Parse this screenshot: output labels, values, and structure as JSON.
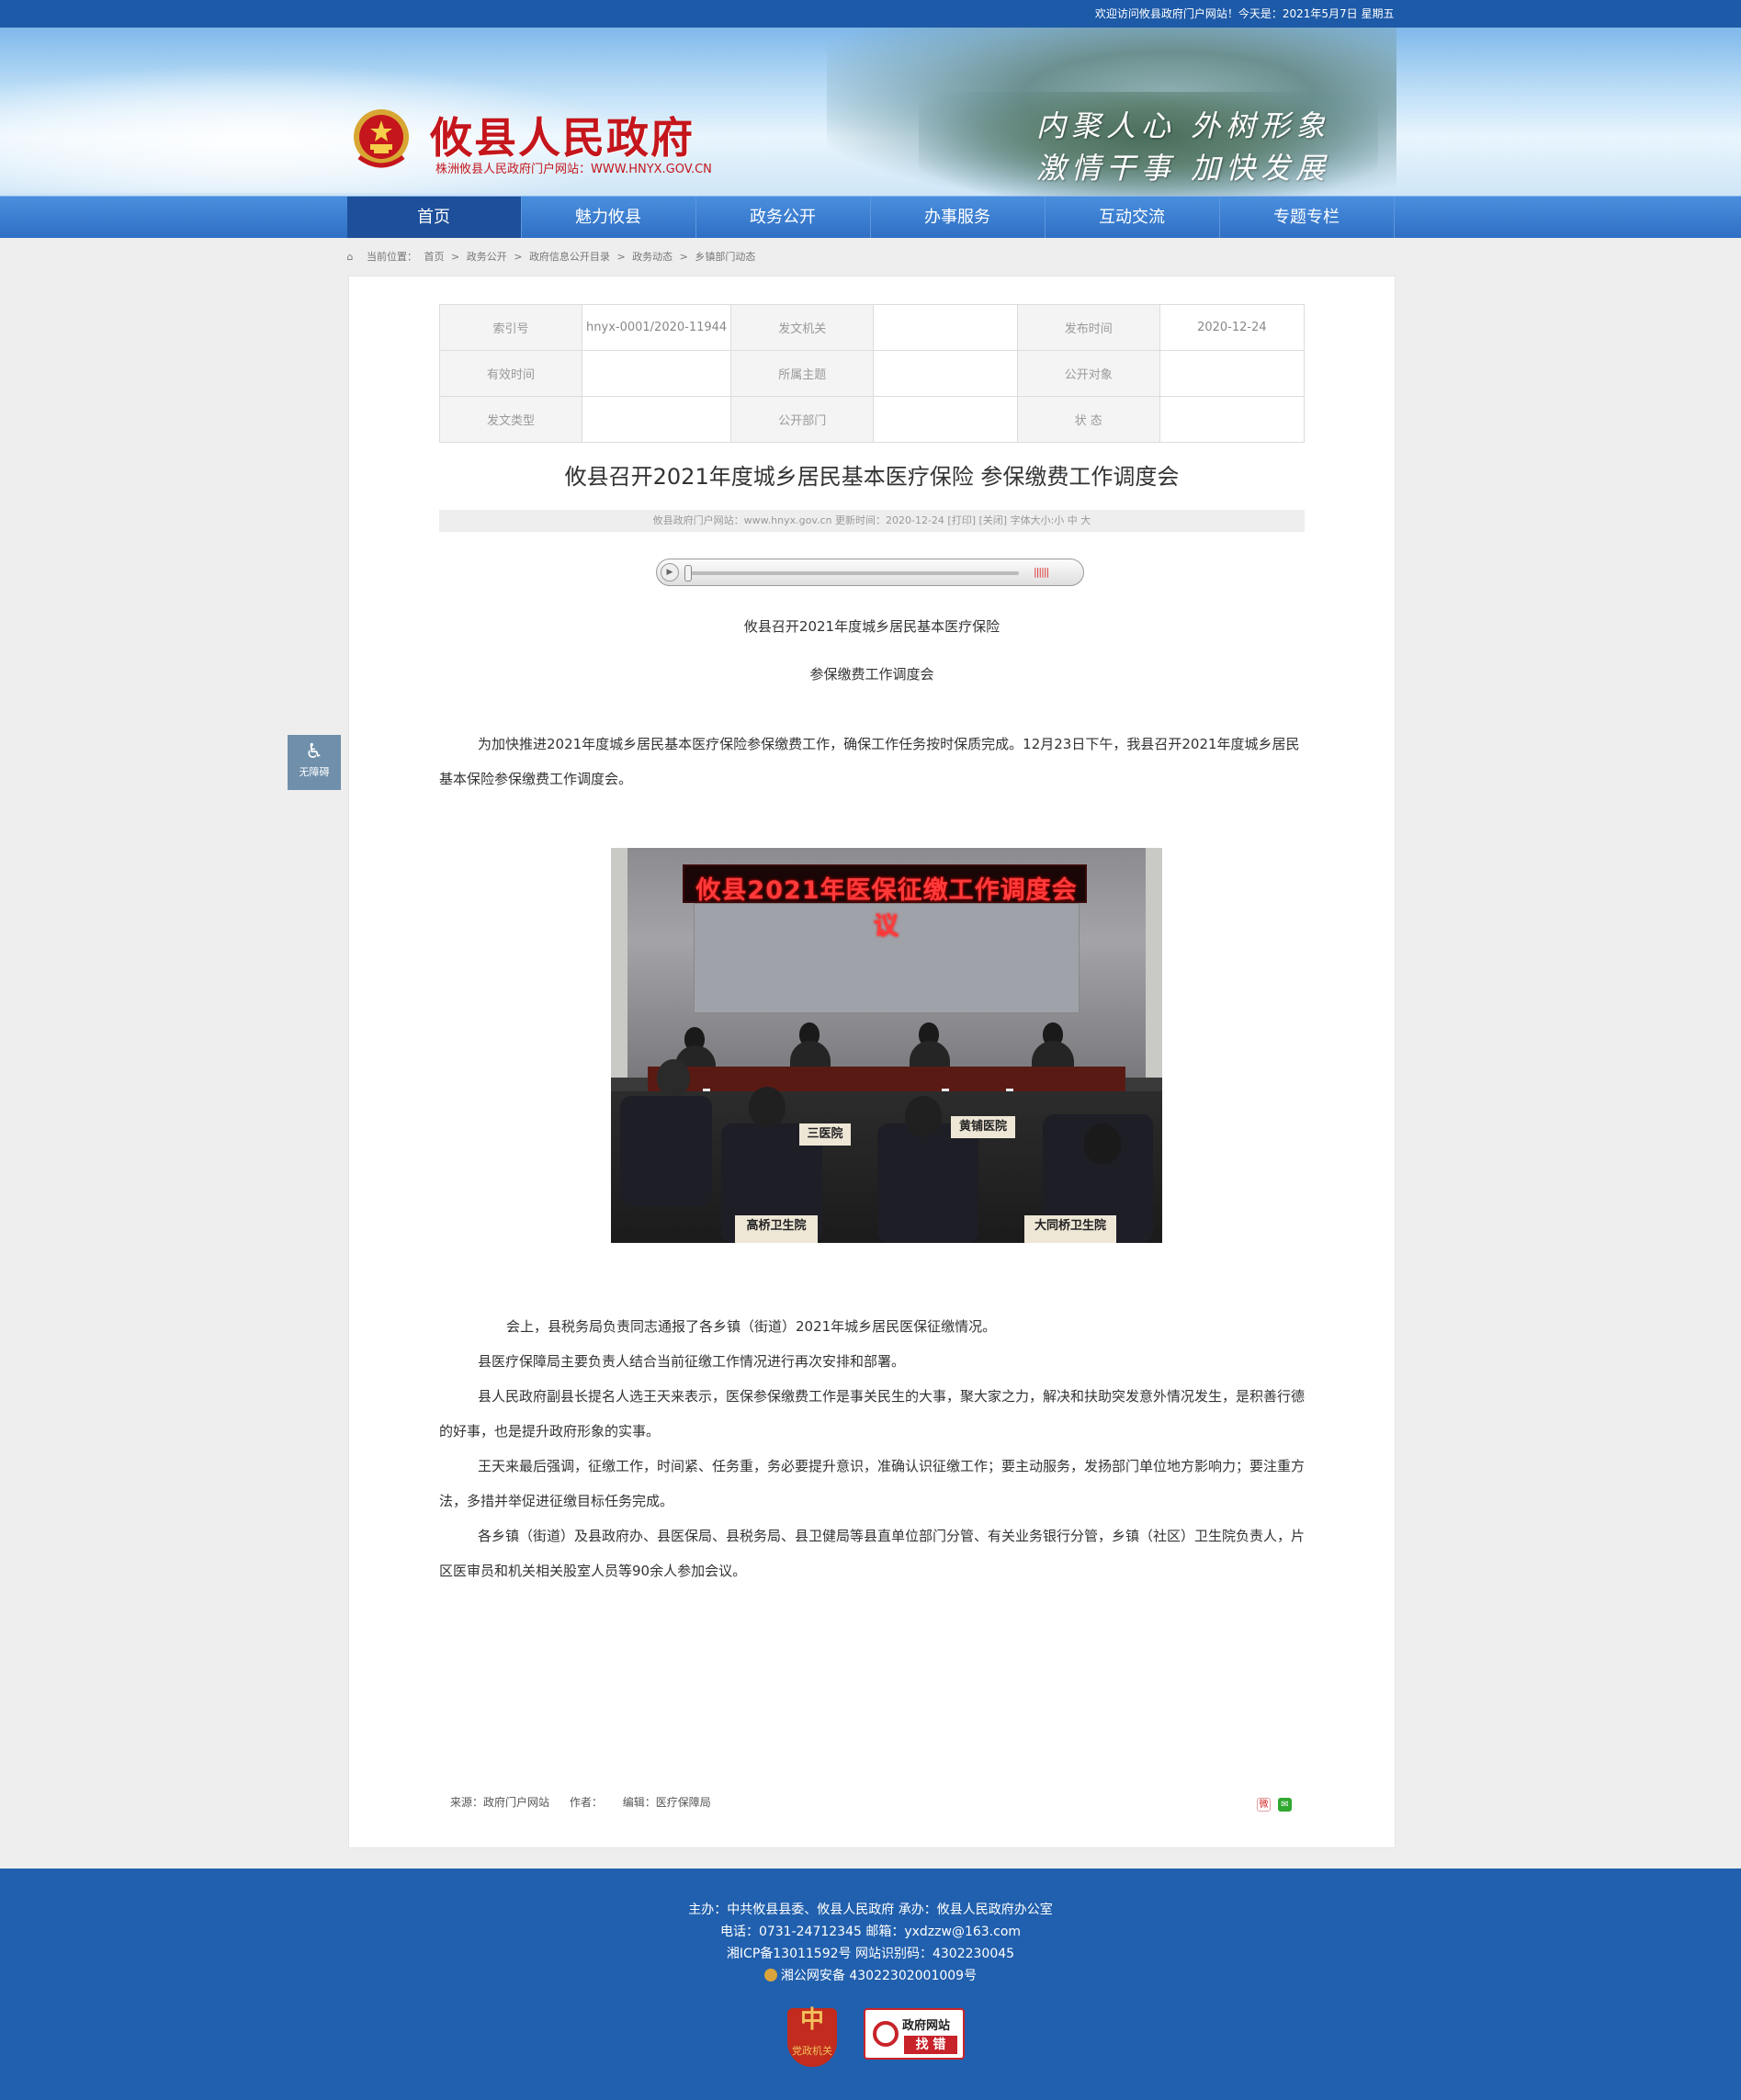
{
  "topbar": {
    "welcome": "欢迎访问攸县政府门户网站！今天是：2021年5月7日 星期五"
  },
  "header": {
    "site_title": "攸县人民政府",
    "site_sub": "株洲攸县人民政府门户网站：WWW.HNYX.GOV.CN",
    "slogan_line1": "内聚人心 外树形象",
    "slogan_line2": "激情干事 加快发展",
    "emblem_icon": "national-emblem-icon"
  },
  "nav": {
    "items": [
      "首页",
      "魅力攸县",
      "政务公开",
      "办事服务",
      "互动交流",
      "专题专栏"
    ],
    "active_index": 0
  },
  "breadcrumb": {
    "home_icon": "home-icon",
    "label": "当前位置：",
    "items": [
      "首页",
      ">",
      "政务公开",
      ">",
      "政府信息公开目录",
      ">",
      "政务动态",
      ">",
      "乡镇部门动态"
    ]
  },
  "meta": {
    "rows": [
      [
        {
          "k": "索引号",
          "v": "hnyx-0001/2020-11944"
        },
        {
          "k": "发文机关",
          "v": ""
        },
        {
          "k": "发布时间",
          "v": "2020-12-24"
        }
      ],
      [
        {
          "k": "有效时间",
          "v": ""
        },
        {
          "k": "所属主题",
          "v": ""
        },
        {
          "k": "公开对象",
          "v": ""
        }
      ],
      [
        {
          "k": "发文类型",
          "v": ""
        },
        {
          "k": "公开部门",
          "v": ""
        },
        {
          "k": "状  态",
          "v": ""
        }
      ]
    ]
  },
  "article": {
    "title": "攸县召开2021年度城乡居民基本医疗保险 参保缴费工作调度会",
    "infobar": "攸县政府门户网站：www.hnyx.gov.cn   更新时间：2020-12-24   [打印]  [关闭]   字体大小:小 中 大",
    "heading_line1": "攸县召开2021年度城乡居民基本医疗保险",
    "heading_line2": "参保缴费工作调度会",
    "intro": "为加快推进2021年度城乡居民基本医疗保险参保缴费工作，确保工作任务按时保质完成。12月23日下午，我县召开2021年度城乡居民基本保险参保缴费工作调度会。",
    "photo": {
      "led": "攸县2021年医保征缴工作调度会议",
      "plates": [
        "三医院",
        "黄铺医院",
        "高桥卫生院",
        "大同桥卫生院"
      ]
    },
    "paragraphs": [
      "会上，县税务局负责同志通报了各乡镇（街道）2021年城乡居民医保征缴情况。",
      "县医疗保障局主要负责人结合当前征缴工作情况进行再次安排和部署。",
      "县人民政府副县长提名人选王天来表示，医保参保缴费工作是事关民生的大事，聚大家之力，解决和扶助突发意外情况发生，是积善行德的好事，也是提升政府形象的实事。",
      "王天来最后强调，征缴工作，时间紧、任务重，务必要提升意识，准确认识征缴工作；要主动服务，发扬部门单位地方影响力；要注重方法，多措并举促进征缴目标任务完成。",
      "各乡镇（街道）及县政府办、县医保局、县税务局、县卫健局等县直单位部门分管、有关业务银行分管，乡镇（社区）卫生院负责人，片区医审员和机关相关股室人员等90余人参加会议。"
    ],
    "source": "来源：政府门户网站",
    "author": "作者：",
    "editor": "编辑：医疗保障局"
  },
  "accessibility": {
    "icon": "wheelchair-icon",
    "label": "无障碍"
  },
  "footer": {
    "line1": "主办：中共攸县县委、攸县人民政府 承办：攸县人民政府办公室",
    "line2": "电话：0731-24712345 邮箱：yxdzzw@163.com",
    "line3": "湘ICP备13011592号   网站识别码：4302230045",
    "line4": "湘公网安备 43022302001009号",
    "badge1_mark": "中",
    "badge1_label": "党政机关",
    "badge2_line1": "政府网站",
    "badge2_line2": "找 错"
  }
}
